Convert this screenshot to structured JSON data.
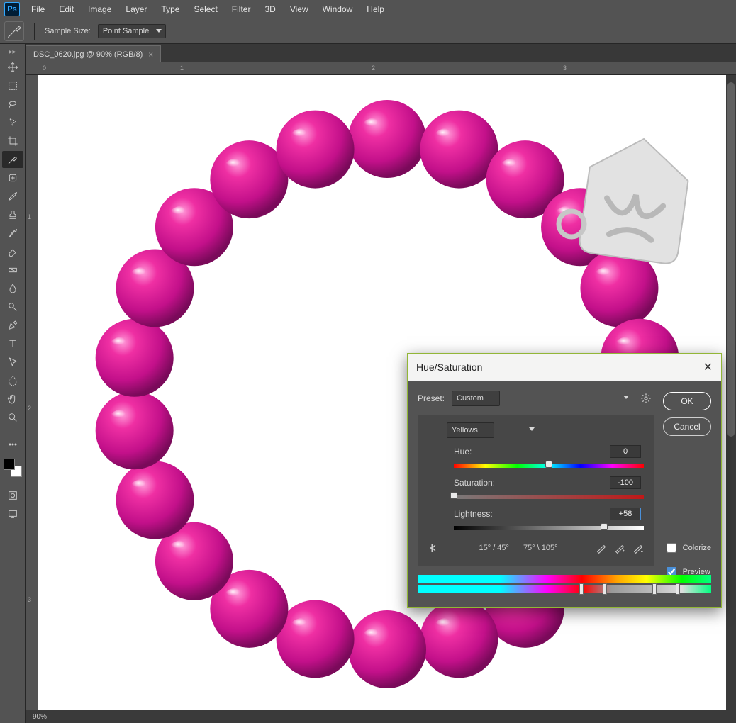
{
  "menubar": {
    "items": [
      "File",
      "Edit",
      "Image",
      "Layer",
      "Type",
      "Select",
      "Filter",
      "3D",
      "View",
      "Window",
      "Help"
    ]
  },
  "options": {
    "sample_label": "Sample Size:",
    "sample_value": "Point Sample"
  },
  "doc_tab": {
    "label": "DSC_0620.jpg @ 90% (RGB/8)"
  },
  "ruler_h": {
    "t0": "0",
    "t1": "1",
    "t2": "2",
    "t3": "3"
  },
  "ruler_v": {
    "t1": "1",
    "t2": "2",
    "t3": "3"
  },
  "dialog": {
    "title": "Hue/Saturation",
    "preset_label": "Preset:",
    "preset_value": "Custom",
    "ok": "OK",
    "cancel": "Cancel",
    "channel": "Yellows",
    "hue_label": "Hue:",
    "hue_value": "0",
    "sat_label": "Saturation:",
    "sat_value": "-100",
    "light_label": "Lightness:",
    "light_value": "+58",
    "range_low": "15° / 45°",
    "range_high": "75° \\ 105°",
    "colorize": "Colorize",
    "preview": "Preview"
  },
  "status": {
    "zoom": "90%"
  }
}
